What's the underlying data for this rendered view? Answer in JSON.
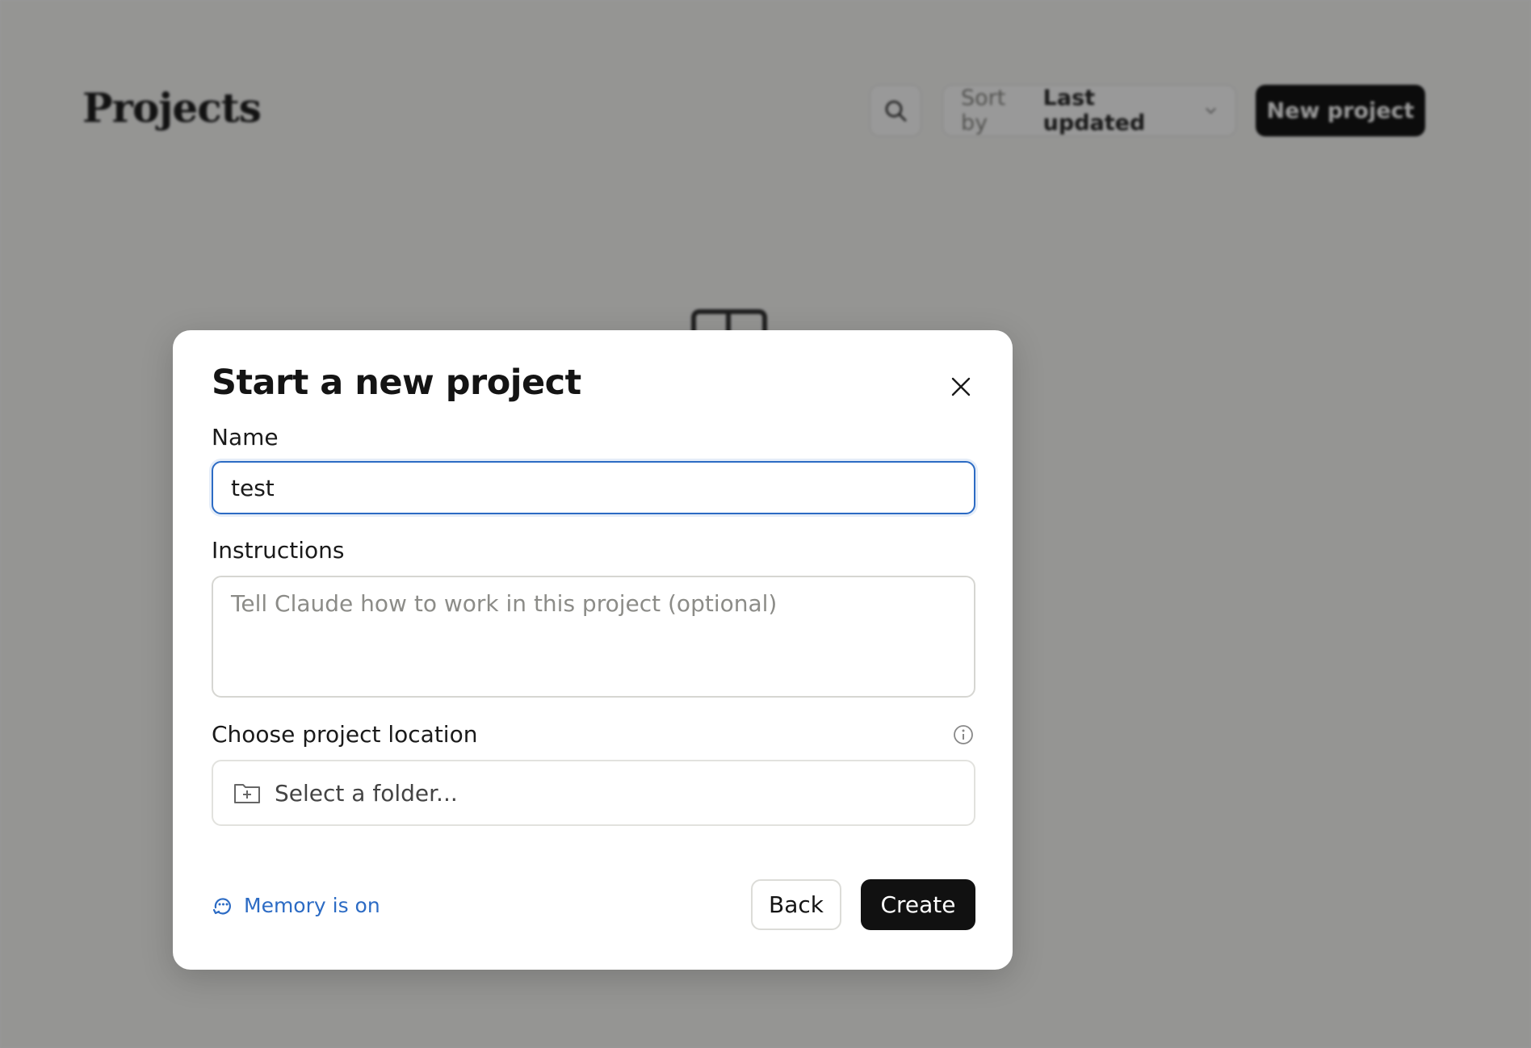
{
  "background": {
    "page_title": "Projects",
    "sort_label": "Sort by",
    "sort_value": "Last updated",
    "new_project_label": "New project"
  },
  "modal": {
    "title": "Start a new project",
    "name_label": "Name",
    "name_value": "test",
    "instructions_label": "Instructions",
    "instructions_placeholder": "Tell Claude how to work in this project (optional)",
    "location_label": "Choose project location",
    "folder_placeholder": "Select a folder...",
    "memory_status": "Memory is on",
    "back_label": "Back",
    "create_label": "Create"
  },
  "icons": {
    "search": "search-icon",
    "chevron": "chevron-down-icon",
    "close": "close-icon",
    "info": "info-icon",
    "folder_add": "folder-plus-icon",
    "memory": "memory-icon"
  },
  "colors": {
    "accent_blue": "#2c6bc4",
    "primary_button": "#111111",
    "overlay": "rgba(0,0,0,0.40)"
  }
}
